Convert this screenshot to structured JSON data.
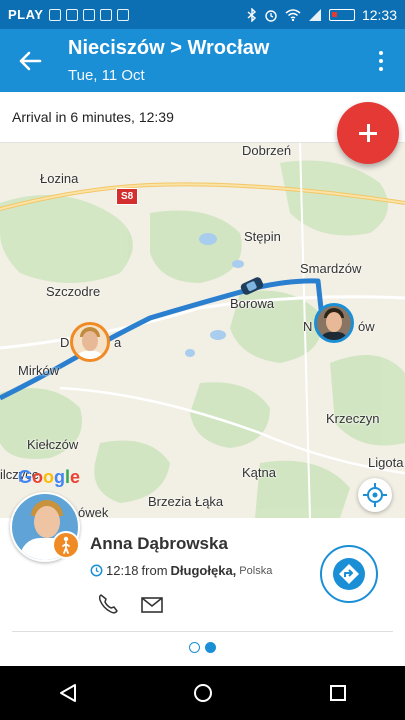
{
  "status_bar": {
    "carrier": "PLAY",
    "time": "12:33"
  },
  "app_bar": {
    "title": "Nieciszów > Wrocław",
    "subtitle": "Tue, 11 Oct"
  },
  "arrival": {
    "text": "Arrival in 6 minutes, 12:39"
  },
  "map": {
    "road_sign": "S8",
    "labels": [
      "Dobrzeń",
      "Łozina",
      "Stępin",
      "Smardzów",
      "Szczodre",
      "Borowa",
      "N",
      "ów",
      "D",
      "a",
      "Mirków",
      "Krzeczyn",
      "Kiełczów",
      "Ligota",
      "ilczyce",
      "Kątna",
      "Brzezia Łąka",
      "ówek"
    ],
    "google": [
      "G",
      "o",
      "o",
      "g",
      "l",
      "e"
    ]
  },
  "person_card": {
    "name": "Anna Dąbrowska",
    "time": "12:18",
    "from_word": "from",
    "place": "Długołęka,",
    "country": "Polska"
  },
  "pager": {
    "pages": 2,
    "active_index": 1
  },
  "colors": {
    "primary": "#1b8fd6",
    "status_bar": "#0d6fb3",
    "accent_fab": "#e53935",
    "walker_badge": "#f08a24",
    "route_line": "#2a7fcf"
  }
}
